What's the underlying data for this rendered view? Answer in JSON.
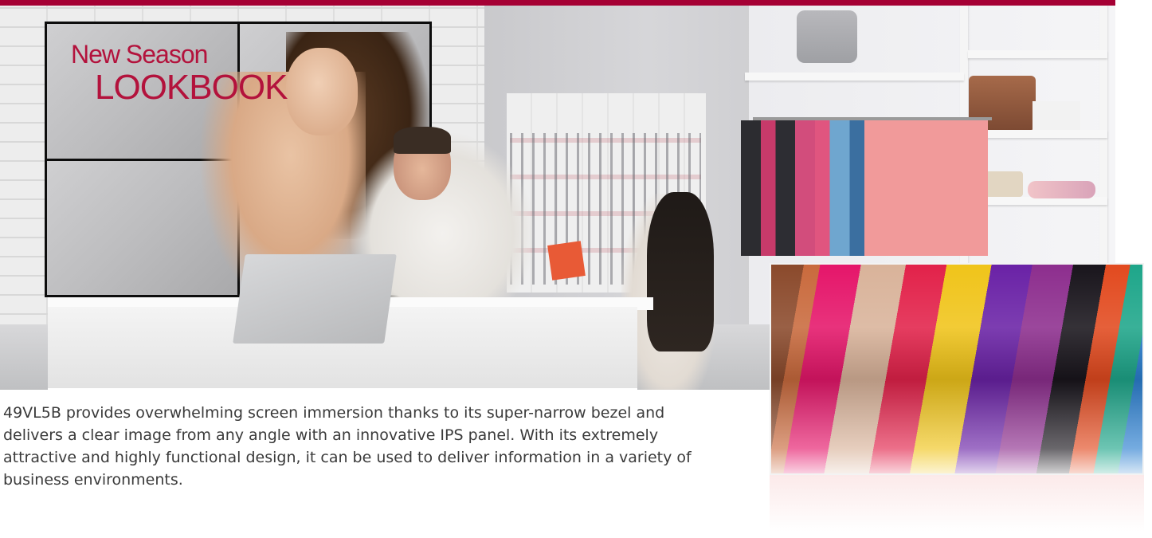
{
  "brand": {
    "accent_color": "#a50034"
  },
  "video_wall": {
    "headline_line1": "New Season",
    "headline_line2": "LOOKBOOK",
    "headline_color": "#b3123c"
  },
  "description": "49VL5B provides overwhelming screen immersion thanks to its super-narrow bezel and delivers a clear image from any angle with an innovative IPS panel. With its extremely attractive and highly functional design, it can be used to deliver information in a variety of business environments."
}
